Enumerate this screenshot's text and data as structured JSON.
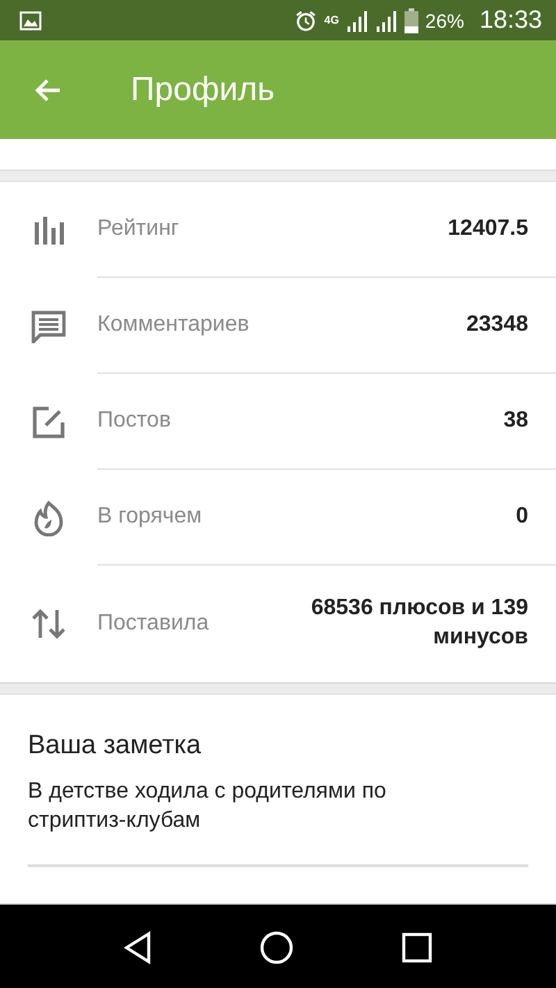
{
  "status_bar": {
    "battery": "26%",
    "time": "18:33",
    "network": "4G"
  },
  "app_bar": {
    "title": "Профиль"
  },
  "stats": [
    {
      "label": "Рейтинг",
      "value": "12407.5"
    },
    {
      "label": "Комментариев",
      "value": "23348"
    },
    {
      "label": "Постов",
      "value": "38"
    },
    {
      "label": "В горячем",
      "value": "0"
    },
    {
      "label": "Поставила",
      "value": "68536 плюсов и 139 минусов"
    }
  ],
  "note": {
    "title": "Ваша заметка",
    "value": "В детстве ходила с родителями по стриптиз-клубам"
  }
}
